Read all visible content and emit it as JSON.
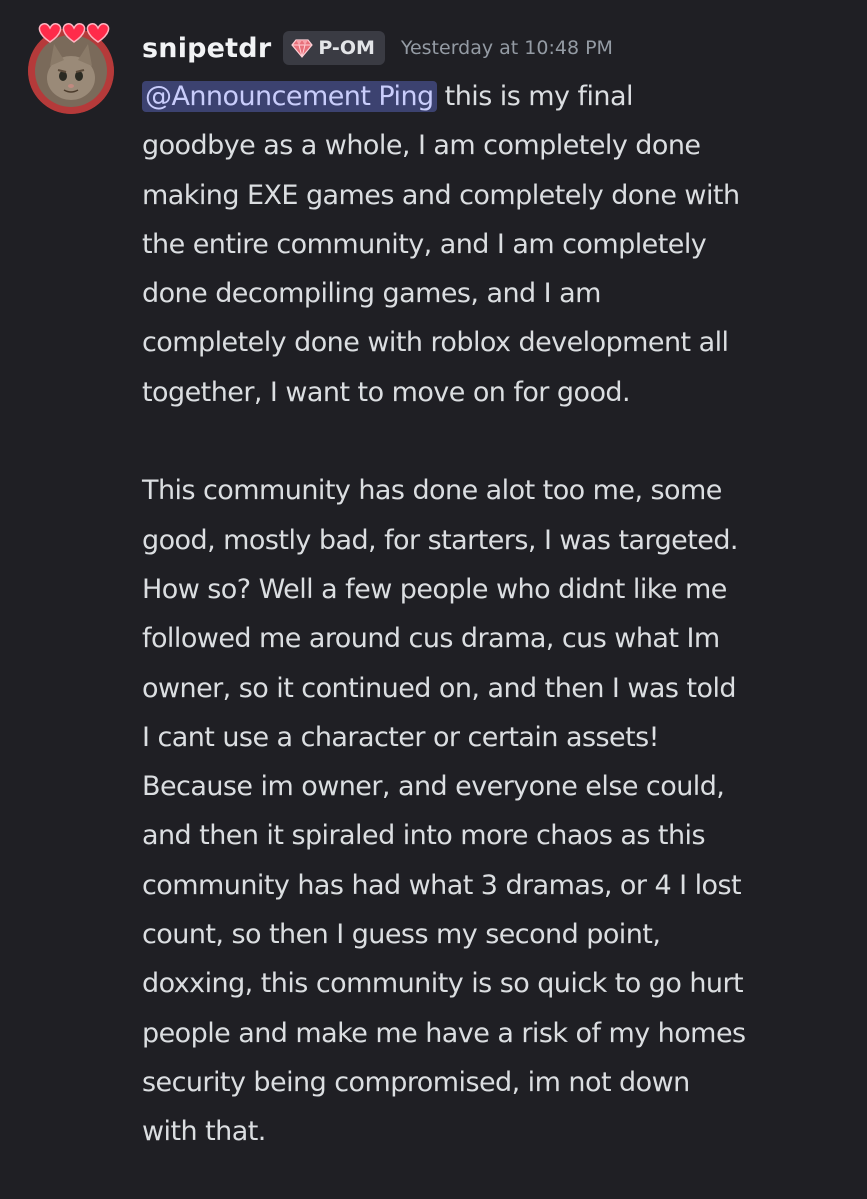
{
  "message": {
    "author": {
      "username": "snipetdr",
      "avatar_icon": "cat-avatar",
      "avatar_decoration": "hearts-decoration",
      "guild_tag": {
        "icon": "gem-icon",
        "label": "P-OM"
      }
    },
    "timestamp": "Yesterday at 10:48 PM",
    "mention": "@Announcement Ping",
    "lines": [
      " this is my final",
      "goodbye as a whole, I am completely done",
      "making EXE games and completely done with",
      "the entire community, and I am completely",
      "done decompiling games, and I am",
      "completely done with roblox development all",
      "together, I want to move on for good.",
      "",
      "This community has done alot too me, some",
      "good, mostly bad, for starters, I was targeted.",
      "How so? Well a few people who didnt like me",
      "followed me around cus drama, cus what Im",
      "owner, so it continued on, and then I was told",
      "I cant use a character or certain assets!",
      "Because im owner, and everyone else could,",
      "and then it spiraled into more chaos as this",
      "community has had what 3 dramas, or 4 I lost",
      "count, so then I guess my second point,",
      "doxxing, this community is so quick to go hurt",
      "people and make me have a risk of my homes",
      "security being compromised, im not down",
      "with that."
    ]
  },
  "colors": {
    "background": "#1f1f24",
    "text": "#dbdee1",
    "username": "#f2f3f5",
    "timestamp": "#949ba4",
    "mention_bg": "#3c4270",
    "mention_text": "#c9cdfb",
    "tag_bg": "#3a3b43"
  }
}
